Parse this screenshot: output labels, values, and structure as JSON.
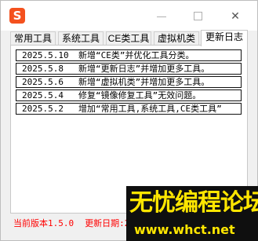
{
  "window": {
    "app_icon_glyph": "S",
    "controls": {
      "minimize": "minimize",
      "maximize": "maximize",
      "close": "✕"
    }
  },
  "tabs": [
    {
      "label": "常用工具",
      "active": false
    },
    {
      "label": "系统工具",
      "active": false
    },
    {
      "label": "CE类工具",
      "active": false
    },
    {
      "label": "虚拟机类",
      "active": false
    },
    {
      "label": "更新日志",
      "active": true
    }
  ],
  "changelog": [
    {
      "date": "2025.5.10",
      "text": "新增“CE类”并优化工具分类。"
    },
    {
      "date": "2025.5.8",
      "text": "新增“更新日志”并增加更多工具。"
    },
    {
      "date": "2025.5.6",
      "text": "新增“虚拟机类”并增加更多工具。"
    },
    {
      "date": "2025.5.4",
      "text": "修复“镜像修复工具”无效问题。"
    },
    {
      "date": "2025.5.2",
      "text": "增加“常用工具,系统工具,CE类工具”"
    }
  ],
  "status": {
    "version": "当前版本1.5.0",
    "update_date": "更新日期:20"
  },
  "watermark": {
    "title": "无忧编程论坛",
    "url": "www.whct.net"
  },
  "colors": {
    "status_text": "#ff0000",
    "watermark_text": "#ffe600",
    "app_icon": "#f4511e"
  }
}
